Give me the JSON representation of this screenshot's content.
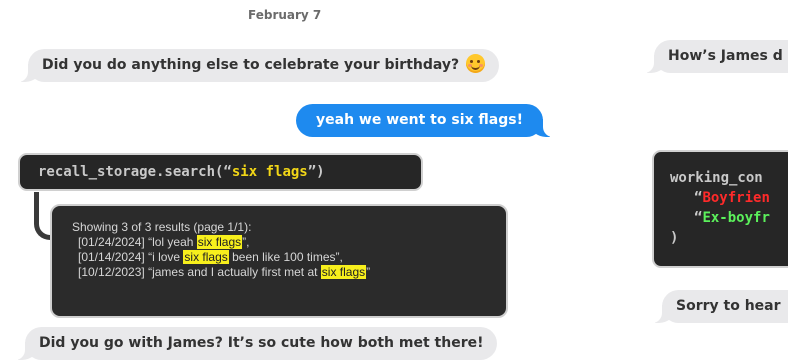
{
  "date_header": "February 7",
  "left_column": {
    "msg_question": "Did you do anything else to celebrate your birthday?",
    "msg_question_emoji": "smiling-face-icon",
    "msg_reply": "yeah we went to six flags!",
    "tool_call": {
      "prefix": "recall_storage.search(“",
      "query": "six flags",
      "suffix": "”)"
    },
    "tool_result": {
      "header": "Showing 3 of 3 results (page 1/1):",
      "rows": [
        {
          "date": "[01/24/2024]",
          "before": " “lol yeah ",
          "highlight": "six flags",
          "after": "”,"
        },
        {
          "date": "[01/14/2024]",
          "before": " “i love ",
          "highlight": "six flags",
          "after": " been like 100 times”,"
        },
        {
          "date": "[10/12/2023]",
          "before": " “james and I actually first met at ",
          "highlight": "six flags",
          "after": "”"
        }
      ]
    },
    "msg_followup": "Did you go with James? It’s so cute how both met there!"
  },
  "right_column": {
    "msg_top": "How’s James d",
    "code_line1": "working_con",
    "code_line2_quote": "“",
    "code_line2_value": "Boyfrien",
    "code_line3_quote": "“",
    "code_line3_value": "Ex-boyfr",
    "code_line4": ")",
    "msg_bottom": "Sorry to hear"
  },
  "colors": {
    "incoming_bubble": "#e9e9eb",
    "outgoing_bubble": "#1e8aef",
    "code_bg": "#262626",
    "highlight_yellow": "#f2d617",
    "highlight_red": "#ff2a2a",
    "highlight_green": "#5bf05b"
  }
}
